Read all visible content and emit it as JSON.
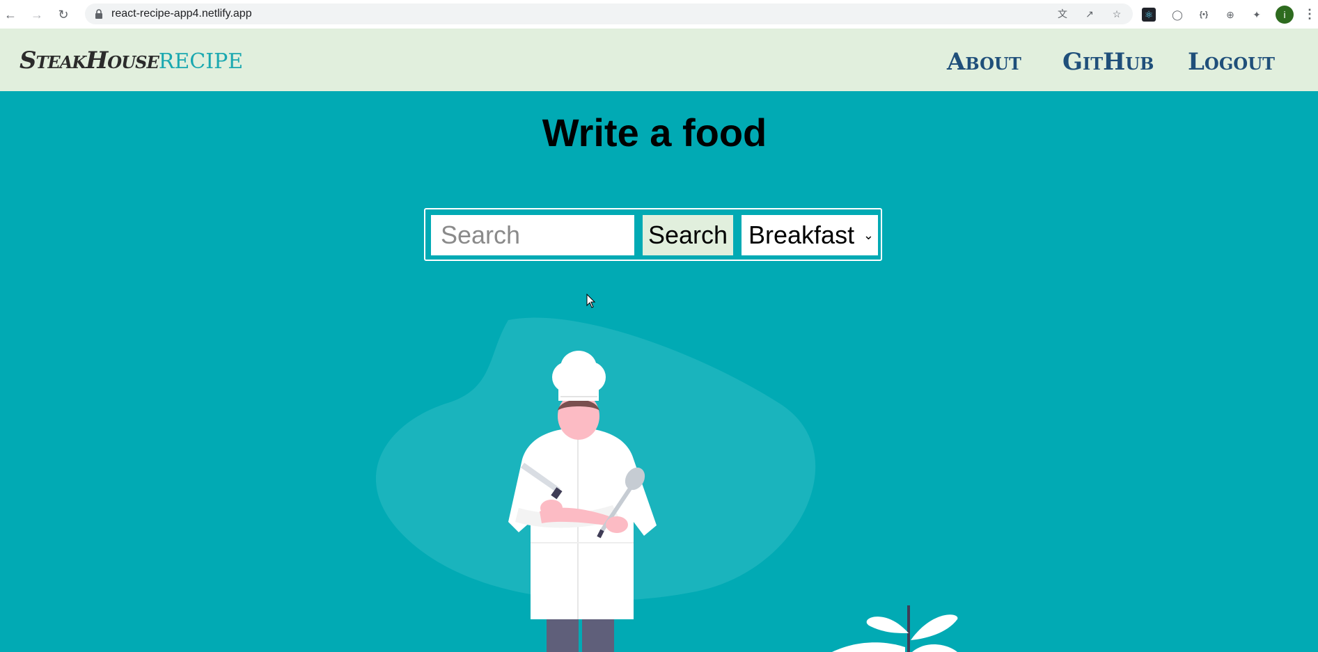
{
  "browser": {
    "url": "react-recipe-app4.netlify.app",
    "icons": [
      "back-icon",
      "forward-icon",
      "reload-icon",
      "lock-icon",
      "translate-icon",
      "share-icon",
      "star-icon",
      "react-devtools-icon",
      "extension-icon",
      "json-icon",
      "code-icon",
      "puzzle-icon"
    ],
    "profile_initial": "i"
  },
  "nav": {
    "brand_primary": "SteakHouse",
    "brand_secondary": "RECIPE",
    "links": [
      "About",
      "GitHub",
      "Logout"
    ]
  },
  "main": {
    "title": "Write a food",
    "search": {
      "placeholder": "Search",
      "value": "",
      "button_label": "Search",
      "category": "Breakfast"
    }
  },
  "colors": {
    "background": "#01aab4",
    "navbar": "#e1efdd",
    "brand_accent": "#1aa8b0",
    "nav_link": "#1f4f7a"
  }
}
